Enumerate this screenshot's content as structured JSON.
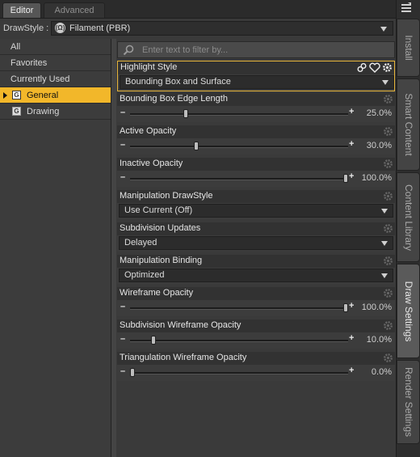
{
  "tabs": {
    "editor": "Editor",
    "advanced": "Advanced"
  },
  "drawstyle": {
    "label": "DrawStyle :",
    "value": "Filament (PBR)"
  },
  "categories": [
    {
      "label": "All"
    },
    {
      "label": "Favorites"
    },
    {
      "label": "Currently Used"
    },
    {
      "label": "General",
      "icon": "G",
      "selected": true
    },
    {
      "label": "Drawing",
      "icon": "G"
    }
  ],
  "filter": {
    "placeholder": "Enter text to filter by..."
  },
  "properties": [
    {
      "title": "Highlight Style",
      "type": "dropdown",
      "value": "Bounding Box and Surface",
      "highlighted": true
    },
    {
      "title": "Bounding Box Edge Length",
      "type": "slider",
      "value": "25.0%",
      "level": 0.25
    },
    {
      "title": "Active Opacity",
      "type": "slider",
      "value": "30.0%",
      "level": 0.3
    },
    {
      "title": "Inactive Opacity",
      "type": "slider",
      "value": "100.0%",
      "level": 1.0
    },
    {
      "title": "Manipulation DrawStyle",
      "type": "dropdown",
      "value": "Use Current (Off)"
    },
    {
      "title": "Subdivision Updates",
      "type": "dropdown",
      "value": "Delayed"
    },
    {
      "title": "Manipulation Binding",
      "type": "dropdown",
      "value": "Optimized"
    },
    {
      "title": "Wireframe Opacity",
      "type": "slider",
      "value": "100.0%",
      "level": 1.0
    },
    {
      "title": "Subdivision Wireframe Opacity",
      "type": "slider",
      "value": "10.0%",
      "level": 0.1
    },
    {
      "title": "Triangulation Wireframe Opacity",
      "type": "slider",
      "value": "0.0%",
      "level": 0.0
    }
  ],
  "right_tabs": [
    "Install",
    "Smart Content",
    "Content Library",
    "Draw Settings",
    "Render Settings"
  ],
  "active_right_tab": "Draw Settings",
  "colors": {
    "accent": "#f2b72a",
    "panel": "#3a3a3a",
    "header": "#323232"
  }
}
